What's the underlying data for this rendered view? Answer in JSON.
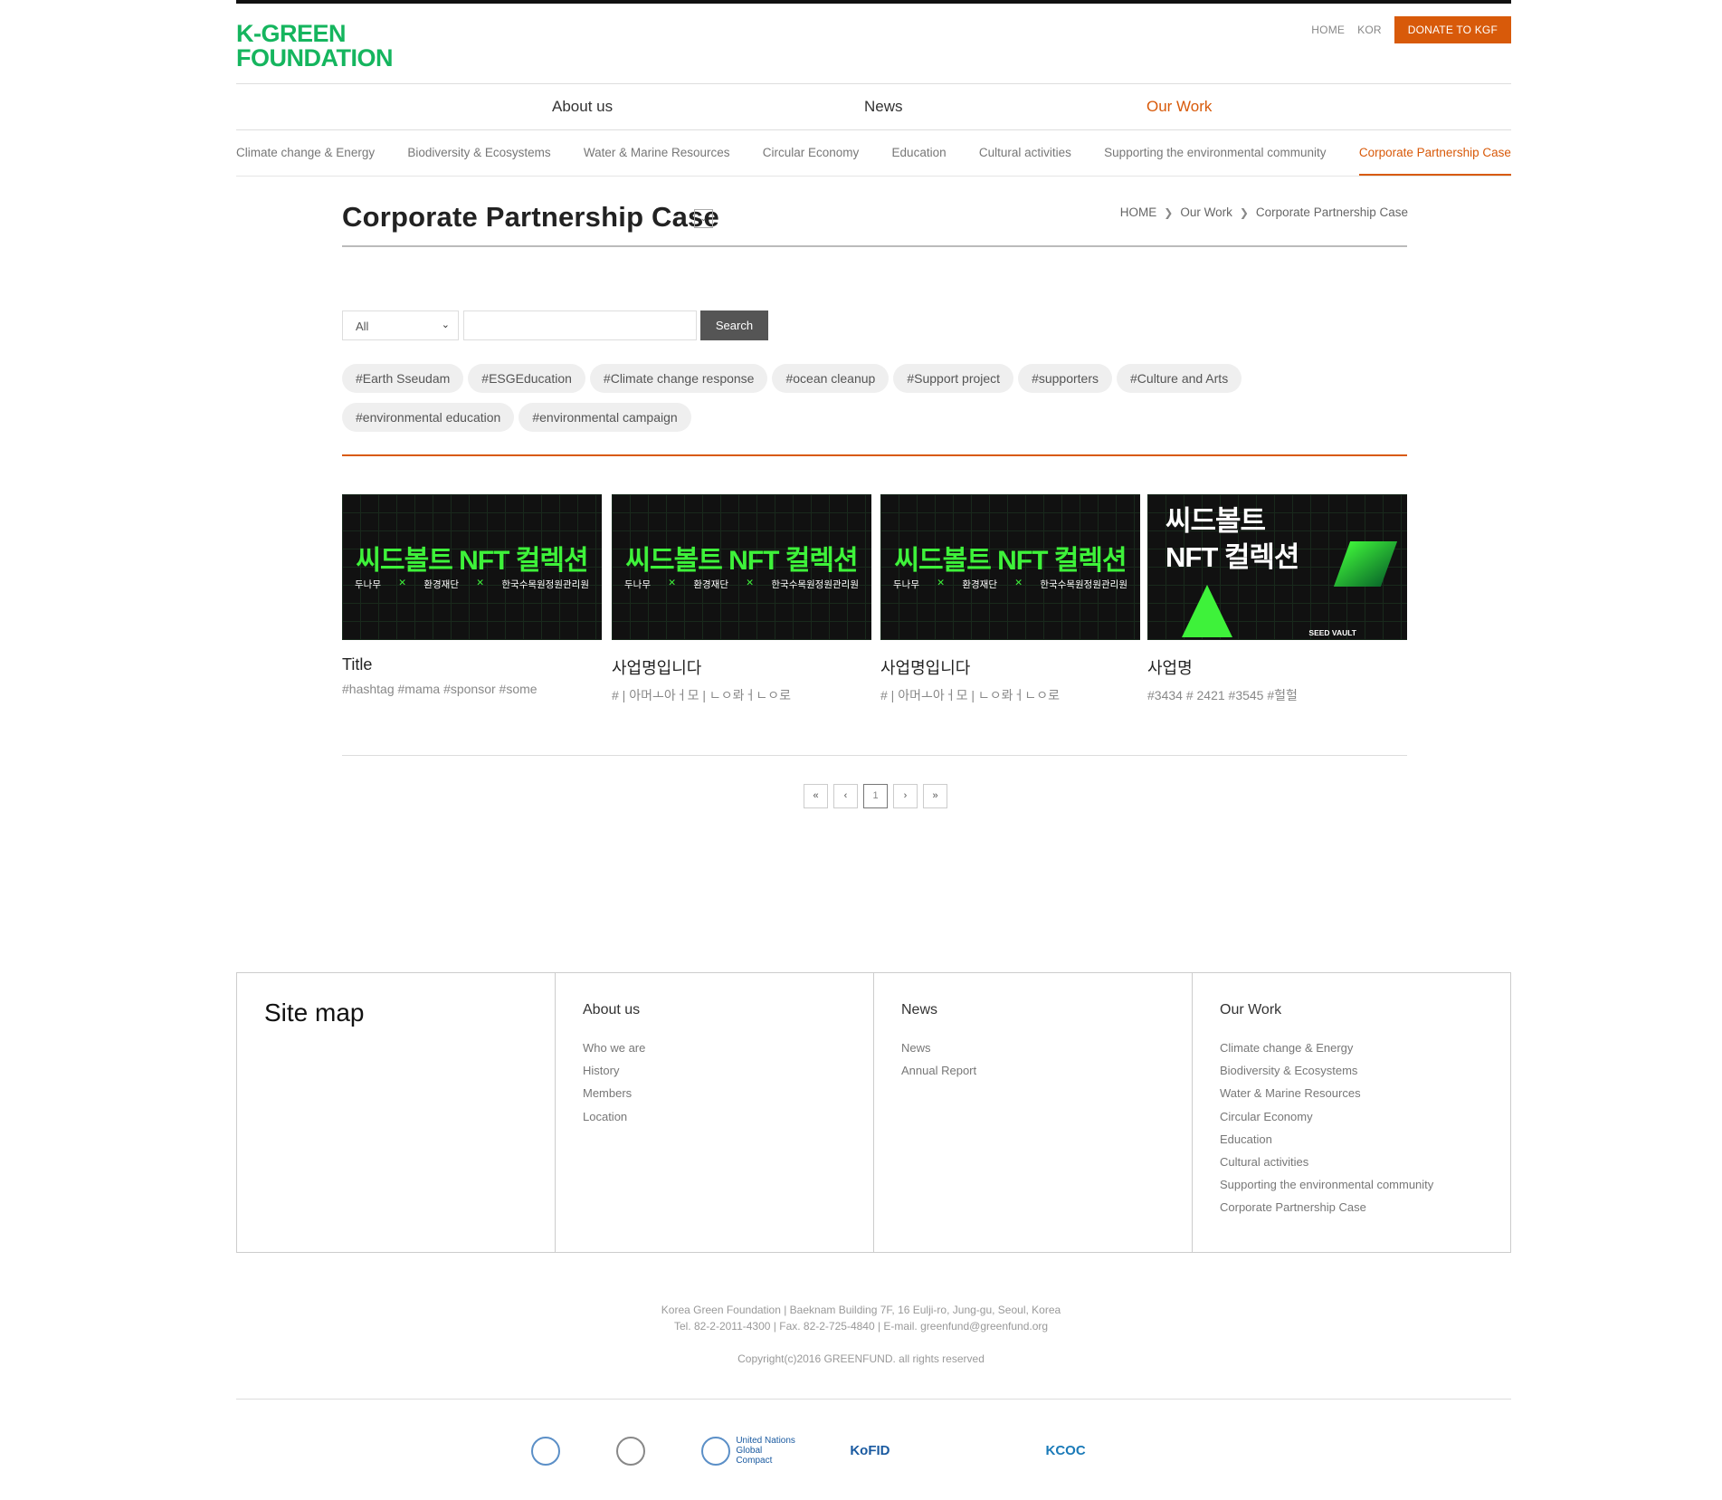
{
  "header": {
    "logo_line1": "K-GREEN",
    "logo_line2": "FOUNDATION",
    "util_home": "HOME",
    "util_lang": "KOR",
    "donate": "DONATE TO KGF"
  },
  "gnb": {
    "about": "About us",
    "news": "News",
    "work": "Our Work"
  },
  "lnb": [
    "Climate change & Energy",
    "Biodiversity & Ecosystems",
    "Water & Marine Resources",
    "Circular Economy",
    "Education",
    "Cultural activities",
    "Supporting the environmental community",
    "Corporate Partnership Case"
  ],
  "page": {
    "title": "Corporate Partnership Case",
    "toggle_icon": "chevron-down-icon",
    "breadcrumb": [
      "HOME",
      "Our Work",
      "Corporate Partnership Case"
    ]
  },
  "search": {
    "select_value": "All",
    "input_value": "",
    "button": "Search"
  },
  "hashtags": [
    "#Earth Sseudam",
    "#ESGEducation",
    "#Climate change response",
    "#ocean cleanup",
    "#Support project",
    "#supporters",
    "#Culture and Arts",
    "#environmental education",
    "#environmental campaign"
  ],
  "cards": [
    {
      "image_headline": "씨드볼트 NFT 컬렉션",
      "image_partners": [
        "두나무",
        "환경재단",
        "한국수목원정원관리원"
      ],
      "title": "Title",
      "tags": "#hashtag #mama #sponsor #some"
    },
    {
      "image_headline": "씨드볼트 NFT 컬렉션",
      "image_partners": [
        "두나무",
        "환경재단",
        "한국수목원정원관리원"
      ],
      "title": "사업명입니다",
      "tags": "# | 아머ㅗ아ㅓ모 | ㄴㅇ롸ㅓㄴㅇ로"
    },
    {
      "image_headline": "씨드볼트 NFT 컬렉션",
      "image_partners": [
        "두나무",
        "환경재단",
        "한국수목원정원관리원"
      ],
      "title": "사업명입니다",
      "tags": "# | 아머ㅗ아ㅓ모 | ㄴㅇ롸ㅓㄴㅇ로"
    },
    {
      "image_line1": "씨드볼트",
      "image_line2": "NFT 컬렉션",
      "image_brand": "SEED VAULT",
      "title": "사업명",
      "tags": "#3434 # 2421 #3545 #헐헐"
    }
  ],
  "pager": {
    "first": "«",
    "prev": "‹",
    "current": "1",
    "next": "›",
    "last": "»"
  },
  "sitemap": {
    "title": "Site map",
    "about": {
      "heading": "About us",
      "items": [
        "Who we are",
        "History",
        "Members",
        "Location"
      ]
    },
    "news": {
      "heading": "News",
      "items": [
        "News",
        "Annual Report"
      ]
    },
    "work": {
      "heading": "Our Work",
      "items": [
        "Climate change & Energy",
        "Biodiversity & Ecosystems",
        "Water & Marine Resources",
        "Circular Economy",
        "Education",
        "Cultural activities",
        "Supporting the environmental community",
        "Corporate Partnership Case"
      ]
    }
  },
  "footer": {
    "address": "Korea Green Foundation | Baeknam Building 7F, 16 Eulji-ro, Jung-gu, Seoul, Korea",
    "contact": "Tel. 82-2-2011-4300 | Fax. 82-2-725-4840 | E-mail. greenfund@greenfund.org",
    "copyright": "Copyright(c)2016 GREENFUND. all rights reserved",
    "partners": [
      {
        "text": "",
        "icon": "ecosoc-logo"
      },
      {
        "text": "",
        "icon": "ngo-logo"
      },
      {
        "text": "United Nations Global Compact",
        "icon": "un-global-compact-logo"
      },
      {
        "text": "KoFID",
        "icon": "kofid-logo"
      },
      {
        "text": "KCOC",
        "icon": "kcoc-logo"
      }
    ]
  },
  "colors": {
    "brand_green": "#15b55e",
    "accent_orange": "#d85a0a"
  }
}
